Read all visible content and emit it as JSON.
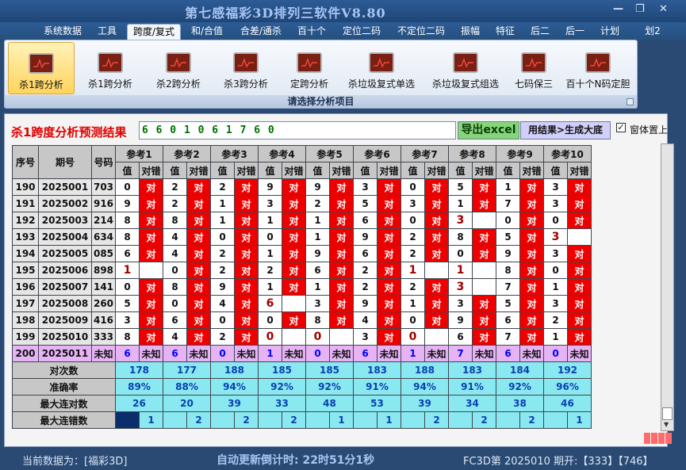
{
  "window": {
    "title": "第七感福彩3D排列三软件V8.80",
    "controls": [
      "—",
      "❐",
      "✕"
    ]
  },
  "menu": {
    "items": [
      "系统数据",
      "工具",
      "跨度/复式",
      "和/合值",
      "合差/通杀",
      "百十个",
      "定位二码",
      "不定位二码",
      "振幅",
      "特征",
      "后二",
      "后一",
      "计划",
      "划2"
    ],
    "active_index": 2
  },
  "ribbon": {
    "buttons": [
      "杀1跨分析",
      "杀1跨分析",
      "杀2跨分析",
      "杀3跨分析",
      "定跨分析",
      "杀垃圾复式单选",
      "杀垃圾复式组选",
      "七码保三",
      "百十个N码定胆"
    ],
    "selected_index": 0,
    "icon_name": "chart-icon",
    "caption": "请选择分析项目"
  },
  "prediction": {
    "label": "杀1跨度分析预测结果",
    "value": "6 6 0 1 0 6 1 7 6 0",
    "export_button": "导出excel",
    "generate_button": "用结果>生成大底",
    "topmost_checked": true,
    "topmost_label": "窗体置上"
  },
  "table": {
    "col_headers": {
      "seq": "序号",
      "period": "期号",
      "number": "号码"
    },
    "ref_headers": [
      "参考1",
      "参考2",
      "参考3",
      "参考4",
      "参考5",
      "参考6",
      "参考7",
      "参考8",
      "参考9",
      "参考10"
    ],
    "sub_headers": {
      "value": "值",
      "check": "对错"
    },
    "correct_text": "对",
    "rows": [
      {
        "seq": "190",
        "period": "2025001",
        "number": "703",
        "values": [
          "0",
          "2",
          "2",
          "9",
          "9",
          "3",
          "0",
          "5",
          "1",
          "3"
        ],
        "ok": [
          1,
          1,
          1,
          1,
          1,
          1,
          1,
          1,
          1,
          1
        ]
      },
      {
        "seq": "191",
        "period": "2025002",
        "number": "916",
        "values": [
          "9",
          "2",
          "1",
          "3",
          "2",
          "5",
          "3",
          "1",
          "7",
          "3"
        ],
        "ok": [
          1,
          1,
          1,
          1,
          1,
          1,
          1,
          1,
          1,
          1
        ]
      },
      {
        "seq": "192",
        "period": "2025003",
        "number": "214",
        "values": [
          "8",
          "8",
          "1",
          "1",
          "1",
          "6",
          "0",
          "3",
          "0",
          "0"
        ],
        "ok": [
          1,
          1,
          1,
          1,
          1,
          1,
          1,
          0,
          1,
          1
        ]
      },
      {
        "seq": "193",
        "period": "2025004",
        "number": "634",
        "values": [
          "8",
          "4",
          "0",
          "0",
          "1",
          "9",
          "2",
          "8",
          "5",
          "3"
        ],
        "ok": [
          1,
          1,
          1,
          1,
          1,
          1,
          1,
          1,
          1,
          0
        ]
      },
      {
        "seq": "194",
        "period": "2025005",
        "number": "085",
        "values": [
          "6",
          "4",
          "2",
          "1",
          "9",
          "6",
          "2",
          "0",
          "9",
          "3"
        ],
        "ok": [
          1,
          1,
          1,
          1,
          1,
          1,
          1,
          1,
          1,
          1
        ]
      },
      {
        "seq": "195",
        "period": "2025006",
        "number": "898",
        "values": [
          "1",
          "0",
          "2",
          "2",
          "6",
          "2",
          "1",
          "1",
          "8",
          "0"
        ],
        "ok": [
          0,
          1,
          1,
          1,
          1,
          1,
          0,
          0,
          1,
          1
        ]
      },
      {
        "seq": "196",
        "period": "2025007",
        "number": "141",
        "values": [
          "0",
          "8",
          "9",
          "1",
          "1",
          "2",
          "2",
          "3",
          "7",
          "1"
        ],
        "ok": [
          1,
          1,
          1,
          1,
          1,
          1,
          1,
          0,
          1,
          1
        ]
      },
      {
        "seq": "197",
        "period": "2025008",
        "number": "260",
        "values": [
          "5",
          "0",
          "4",
          "6",
          "3",
          "9",
          "1",
          "3",
          "5",
          "3"
        ],
        "ok": [
          1,
          1,
          1,
          0,
          1,
          1,
          1,
          1,
          1,
          1
        ]
      },
      {
        "seq": "198",
        "period": "2025009",
        "number": "416",
        "values": [
          "3",
          "6",
          "0",
          "0",
          "8",
          "4",
          "0",
          "9",
          "6",
          "2"
        ],
        "ok": [
          1,
          1,
          1,
          1,
          1,
          1,
          1,
          1,
          1,
          1
        ]
      },
      {
        "seq": "199",
        "period": "2025010",
        "number": "333",
        "values": [
          "8",
          "4",
          "2",
          "0",
          "0",
          "3",
          "0",
          "6",
          "7",
          "1"
        ],
        "ok": [
          1,
          1,
          1,
          0,
          0,
          1,
          0,
          1,
          1,
          1
        ]
      }
    ],
    "highlight": [
      [
        5,
        0
      ],
      [
        2,
        7
      ],
      [
        3,
        9
      ],
      [
        5,
        6
      ],
      [
        5,
        7
      ],
      [
        6,
        7
      ],
      [
        7,
        3
      ],
      [
        9,
        3
      ],
      [
        9,
        4
      ],
      [
        9,
        6
      ]
    ],
    "future": {
      "seq": "200",
      "period": "2025011",
      "number": "未知",
      "values": [
        "6",
        "6",
        "0",
        "1",
        "0",
        "6",
        "1",
        "7",
        "6",
        "0"
      ],
      "status": "未知"
    },
    "stats": [
      {
        "label": "对次数",
        "values": [
          "178",
          "177",
          "188",
          "185",
          "185",
          "183",
          "188",
          "183",
          "184",
          "192"
        ]
      },
      {
        "label": "准确率",
        "values": [
          "89%",
          "88%",
          "94%",
          "92%",
          "92%",
          "91%",
          "94%",
          "91%",
          "92%",
          "96%"
        ]
      },
      {
        "label": "最大连对数",
        "values": [
          "26",
          "20",
          "39",
          "33",
          "48",
          "53",
          "39",
          "34",
          "38",
          "46"
        ]
      },
      {
        "label": "最大连错数",
        "values": [
          "1",
          "2",
          "2",
          "2",
          "1",
          "1",
          "2",
          "2",
          "2",
          "1"
        ]
      }
    ]
  },
  "status": {
    "current_data": "当前数据为：[福彩3D]",
    "countdown": "自动更新倒计时:   22时51分1秒",
    "issue": "FC3D第 2025010 期开:【333】【746】"
  }
}
